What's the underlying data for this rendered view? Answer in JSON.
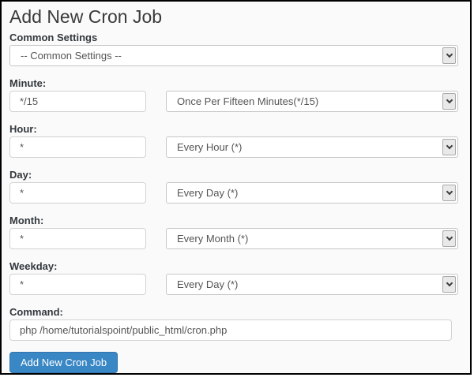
{
  "page": {
    "title": "Add New Cron Job"
  },
  "common_settings": {
    "label": "Common Settings",
    "selected": "-- Common Settings --"
  },
  "fields": [
    {
      "label": "Minute:",
      "value": "*/15",
      "preset": "Once Per Fifteen Minutes(*/15)"
    },
    {
      "label": "Hour:",
      "value": "*",
      "preset": "Every Hour (*)"
    },
    {
      "label": "Day:",
      "value": "*",
      "preset": "Every Day (*)"
    },
    {
      "label": "Month:",
      "value": "*",
      "preset": "Every Month (*)"
    },
    {
      "label": "Weekday:",
      "value": "*",
      "preset": "Every Day (*)"
    }
  ],
  "command": {
    "label": "Command:",
    "value": "php /home/tutorialspoint/public_html/cron.php"
  },
  "submit": {
    "label": "Add New Cron Job"
  },
  "icons": {
    "dropdown": "chevron-down"
  },
  "colors": {
    "button_bg": "#3a87c5",
    "button_border": "#3272ab",
    "frame_border": "#000000",
    "page_bg": "#fafafa"
  }
}
